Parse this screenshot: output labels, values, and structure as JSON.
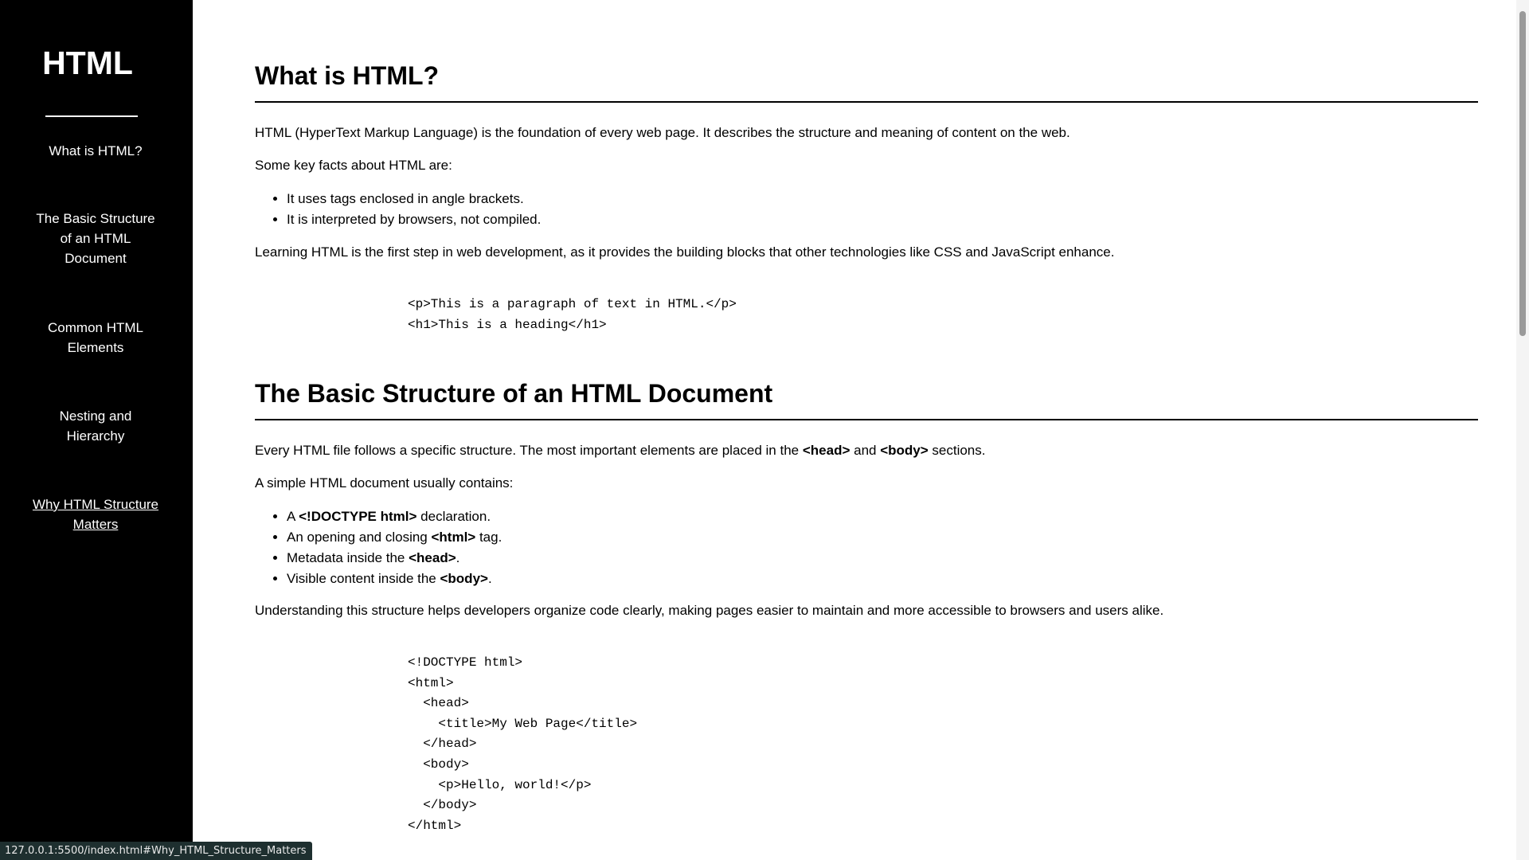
{
  "navbar": {
    "title": "HTML",
    "links": [
      {
        "label": "What is HTML?"
      },
      {
        "label": "The Basic Structure of an HTML Document"
      },
      {
        "label": "Common HTML Elements"
      },
      {
        "label": "Nesting and Hierarchy"
      },
      {
        "label": "Why HTML Structure Matters"
      }
    ]
  },
  "sections": [
    {
      "title": "What is HTML?",
      "para1": "HTML (HyperText Markup Language) is the foundation of every web page. It describes the structure and meaning of content on the web.",
      "para2": "Some key facts about HTML are:",
      "bullets": [
        "It uses tags enclosed in angle brackets.",
        "It is interpreted by browsers, not compiled."
      ],
      "para3": "Learning HTML is the first step in web development, as it provides the building blocks that other technologies like CSS and JavaScript enhance.",
      "code": "<p>This is a paragraph of text in HTML.</p>\n<h1>This is a heading</h1>"
    },
    {
      "title": "The Basic Structure of an HTML Document",
      "para1_a": "Every HTML file follows a specific structure. The most important elements are placed in the ",
      "para1_b": "<head>",
      "para1_c": " and ",
      "para1_d": "<body>",
      "para1_e": " sections.",
      "para2": "A simple HTML document usually contains:",
      "bullets": [
        {
          "pre": "A ",
          "strong": "<!DOCTYPE html>",
          "post": " declaration."
        },
        {
          "pre": "An opening and closing ",
          "strong": "<html>",
          "post": " tag."
        },
        {
          "pre": "Metadata inside the ",
          "strong": "<head>",
          "post": "."
        },
        {
          "pre": "Visible content inside the ",
          "strong": "<body>",
          "post": "."
        }
      ],
      "para3": "Understanding this structure helps developers organize code clearly, making pages easier to maintain and more accessible to browsers and users alike.",
      "code": "<!DOCTYPE html>\n<html>\n  <head>\n    <title>My Web Page</title>\n  </head>\n  <body>\n    <p>Hello, world!</p>\n  </body>\n</html>"
    }
  ],
  "status_bar": {
    "url": "127.0.0.1:5500/index.html#Why_HTML_Structure_Matters"
  }
}
